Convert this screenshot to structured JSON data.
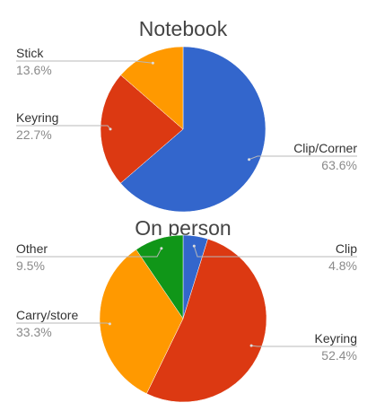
{
  "chart_data": [
    {
      "type": "pie",
      "title": "Notebook",
      "slices": [
        {
          "label": "Clip/Corner",
          "value": 63.6,
          "value_label": "63.6%",
          "color": "#3366cc"
        },
        {
          "label": "Keyring",
          "value": 22.7,
          "value_label": "22.7%",
          "color": "#dc3912"
        },
        {
          "label": "Stick",
          "value": 13.6,
          "value_label": "13.6%",
          "color": "#ff9900"
        }
      ],
      "start_angle_deg": 0,
      "direction": "clockwise",
      "labels": "outside with leader lines"
    },
    {
      "type": "pie",
      "title": "On person",
      "slices": [
        {
          "label": "Clip",
          "value": 4.8,
          "value_label": "4.8%",
          "color": "#3366cc"
        },
        {
          "label": "Keyring",
          "value": 52.4,
          "value_label": "52.4%",
          "color": "#dc3912"
        },
        {
          "label": "Carry/store",
          "value": 33.3,
          "value_label": "33.3%",
          "color": "#ff9900"
        },
        {
          "label": "Other",
          "value": 9.5,
          "value_label": "9.5%",
          "color": "#109618"
        }
      ],
      "start_angle_deg": 0,
      "direction": "clockwise",
      "labels": "outside with leader lines"
    }
  ]
}
